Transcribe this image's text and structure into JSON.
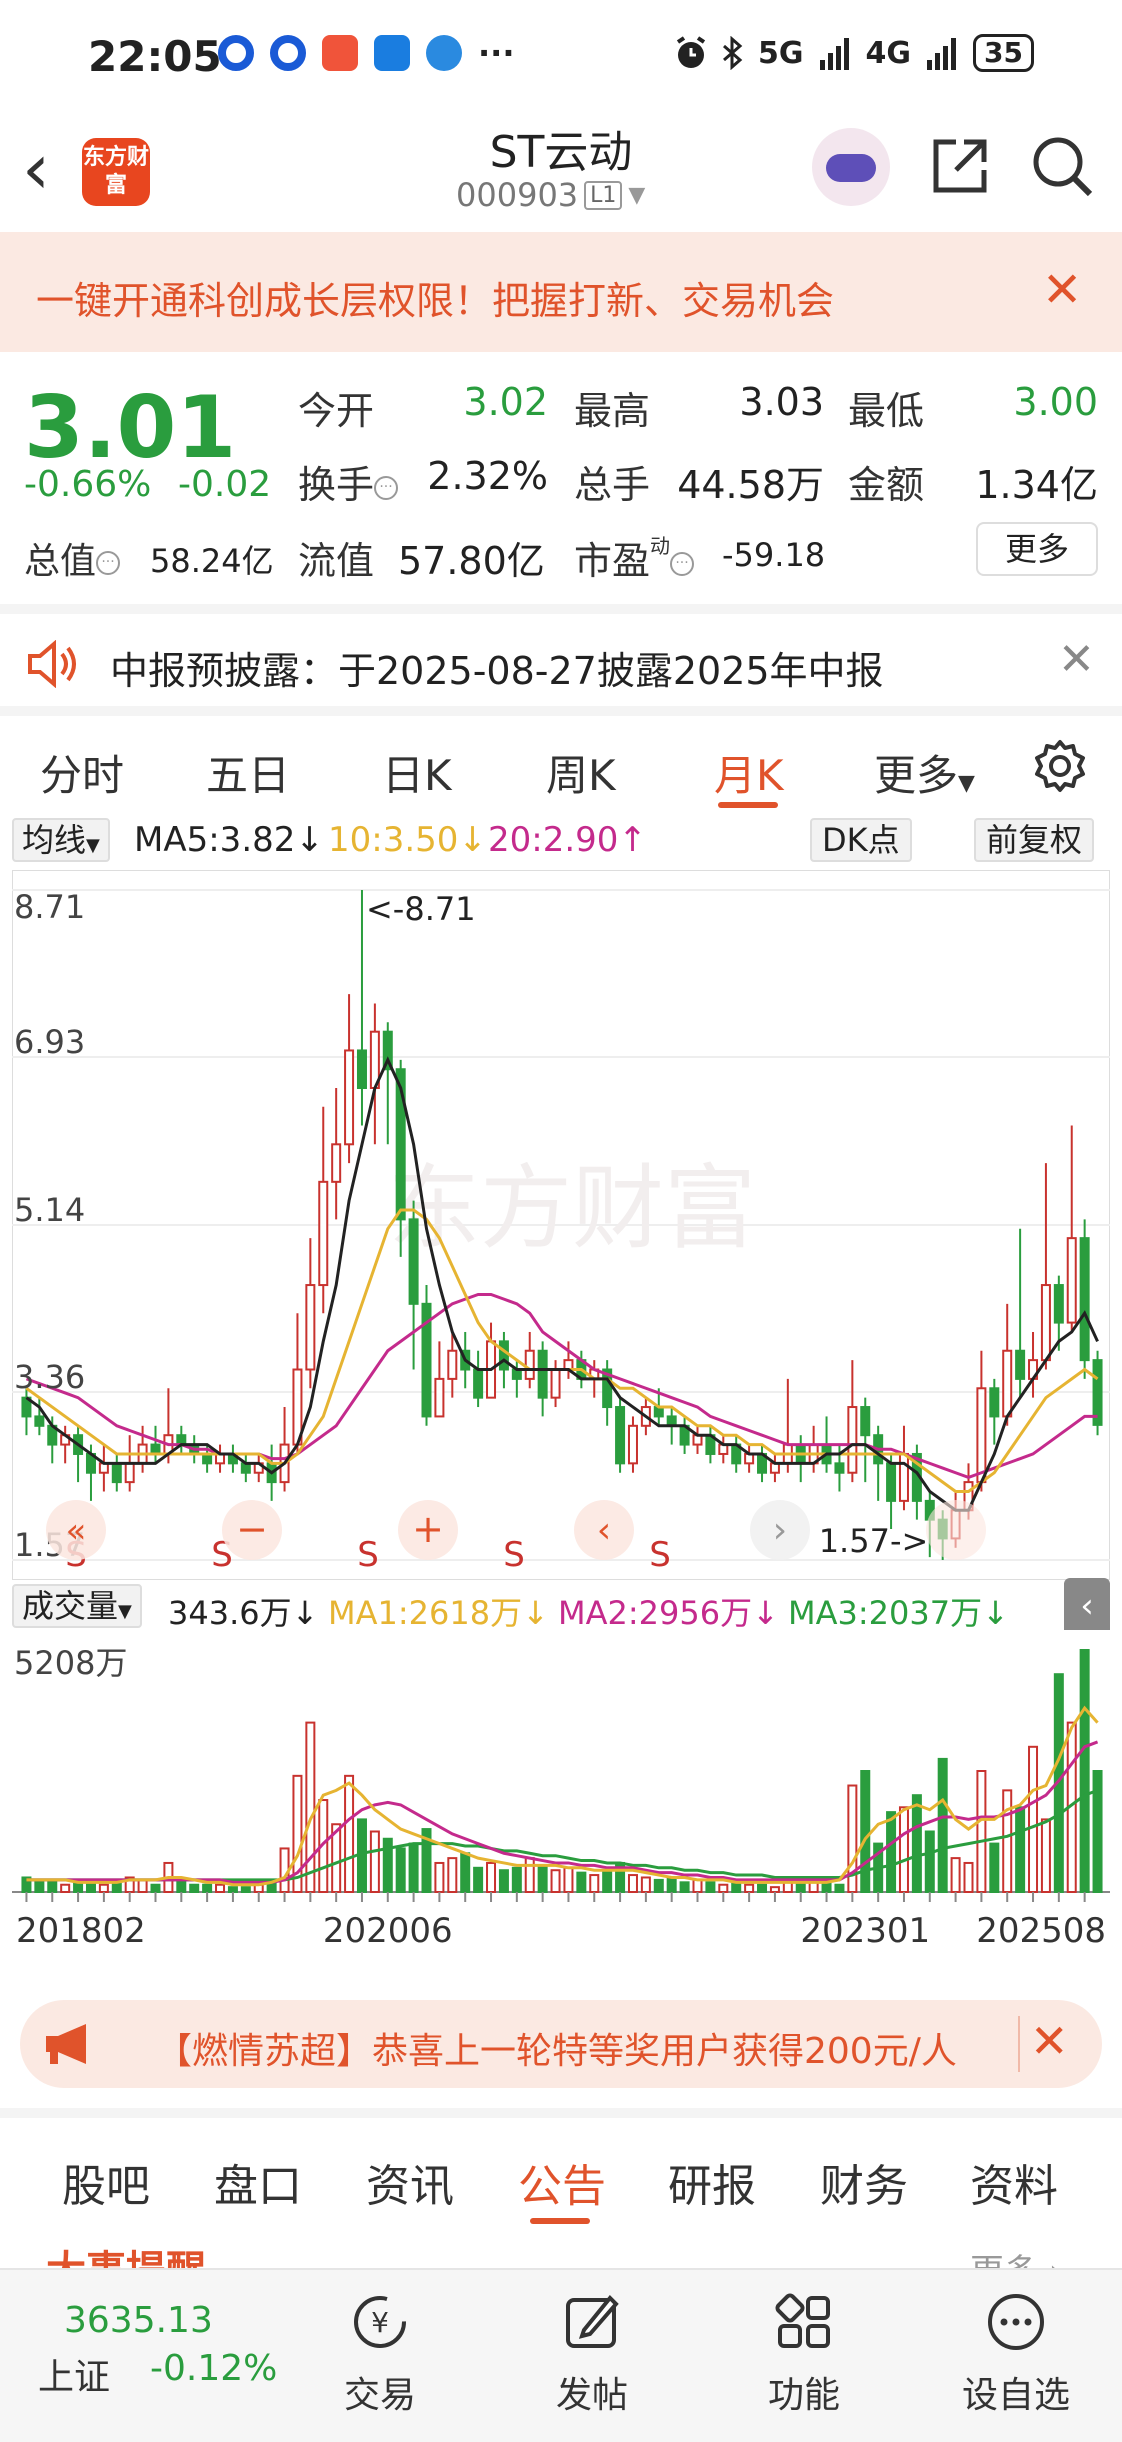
{
  "status_bar": {
    "time": "22:05",
    "network1": "5G",
    "network2": "4G",
    "battery": "35",
    "more": "···"
  },
  "header": {
    "logo_text": "东方财富",
    "stock_name": "ST云动",
    "stock_code": "000903",
    "level": "L1"
  },
  "promo_banner": {
    "text": "一键开通科创成长层权限！把握打新、交易机会"
  },
  "quote": {
    "price": "3.01",
    "change_pct": "-0.66%",
    "change": "-0.02",
    "open_label": "今开",
    "open": "3.02",
    "high_label": "最高",
    "high": "3.03",
    "low_label": "最低",
    "low": "3.00",
    "turnover_label": "换手",
    "turnover": "2.32%",
    "volume_label": "总手",
    "volume": "44.58万",
    "amount_label": "金额",
    "amount": "1.34亿",
    "mktcap_label": "总值",
    "mktcap": "58.24亿",
    "float_label": "流值",
    "float_cap": "57.80亿",
    "pe_label": "市盈",
    "pe_sup": "动",
    "pe": "-59.18",
    "more": "更多"
  },
  "notice": {
    "text": "中报预披露：于2025-08-27披露2025年中报"
  },
  "period_tabs": {
    "items": [
      "分时",
      "五日",
      "日K",
      "周K",
      "月K",
      "更多"
    ],
    "active": "月K"
  },
  "indicator_row": {
    "selector": "均线",
    "ma5": "MA5:3.82↓",
    "ma10": "10:3.50↓",
    "ma20": "20:2.90↑",
    "dk": "DK点",
    "adjust": "前复权"
  },
  "colors": {
    "up": "#c8322e",
    "down": "#2a9d3e",
    "ma5": "#222222",
    "ma10": "#e6b432",
    "ma20": "#c42a8c",
    "accent": "#e0532b"
  },
  "chart_data": [
    {
      "type": "candlestick",
      "y_ticks": [
        "8.71",
        "6.93",
        "5.14",
        "3.36",
        "1.57"
      ],
      "ylim": [
        1.57,
        8.71
      ],
      "max_label": "<-8.71",
      "min_label": "1.57->",
      "watermark": "东方财富",
      "signal_labels": [
        "S",
        "S",
        "S",
        "S",
        "S"
      ],
      "candles": [
        [
          3.3,
          3.1,
          3.4,
          2.9
        ],
        [
          3.1,
          3.0,
          3.3,
          2.9
        ],
        [
          3.0,
          2.8,
          3.1,
          2.6
        ],
        [
          2.8,
          2.9,
          3.0,
          2.6
        ],
        [
          2.9,
          2.7,
          3.0,
          2.4
        ],
        [
          2.7,
          2.5,
          2.8,
          2.2
        ],
        [
          2.5,
          2.6,
          2.8,
          2.3
        ],
        [
          2.6,
          2.4,
          2.7,
          2.3
        ],
        [
          2.4,
          2.6,
          2.9,
          2.3
        ],
        [
          2.6,
          2.8,
          3.0,
          2.5
        ],
        [
          2.8,
          2.7,
          3.0,
          2.6
        ],
        [
          2.7,
          2.9,
          3.4,
          2.6
        ],
        [
          2.9,
          2.8,
          3.0,
          2.7
        ],
        [
          2.8,
          2.7,
          2.9,
          2.6
        ],
        [
          2.7,
          2.6,
          2.8,
          2.5
        ],
        [
          2.6,
          2.7,
          2.8,
          2.5
        ],
        [
          2.7,
          2.6,
          2.8,
          2.5
        ],
        [
          2.6,
          2.5,
          2.7,
          2.4
        ],
        [
          2.5,
          2.6,
          2.7,
          2.4
        ],
        [
          2.6,
          2.4,
          2.8,
          2.2
        ],
        [
          2.4,
          2.8,
          3.2,
          2.3
        ],
        [
          2.8,
          3.6,
          4.2,
          2.7
        ],
        [
          3.6,
          4.5,
          5.0,
          3.4
        ],
        [
          4.5,
          5.6,
          6.4,
          4.2
        ],
        [
          5.6,
          6.0,
          6.6,
          5.2
        ],
        [
          6.0,
          7.0,
          7.6,
          5.8
        ],
        [
          7.0,
          6.6,
          8.71,
          6.2
        ],
        [
          6.6,
          7.2,
          7.5,
          6.0
        ],
        [
          7.2,
          6.8,
          7.3,
          6.0
        ],
        [
          6.8,
          5.2,
          6.9,
          4.8
        ],
        [
          5.2,
          4.3,
          5.4,
          3.6
        ],
        [
          4.3,
          3.1,
          4.5,
          3.0
        ],
        [
          3.1,
          3.5,
          3.9,
          3.1
        ],
        [
          3.5,
          3.8,
          4.0,
          3.3
        ],
        [
          3.8,
          3.6,
          4.0,
          3.4
        ],
        [
          3.6,
          3.3,
          3.8,
          3.2
        ],
        [
          3.3,
          3.9,
          4.1,
          3.3
        ],
        [
          3.9,
          3.6,
          4.0,
          3.4
        ],
        [
          3.6,
          3.5,
          3.7,
          3.3
        ],
        [
          3.5,
          3.8,
          4.0,
          3.4
        ],
        [
          3.8,
          3.3,
          3.9,
          3.1
        ],
        [
          3.3,
          3.6,
          3.7,
          3.2
        ],
        [
          3.6,
          3.7,
          3.9,
          3.5
        ],
        [
          3.7,
          3.5,
          3.8,
          3.4
        ],
        [
          3.5,
          3.6,
          3.7,
          3.3
        ],
        [
          3.6,
          3.2,
          3.7,
          3.0
        ],
        [
          3.2,
          2.6,
          3.3,
          2.5
        ],
        [
          2.6,
          3.0,
          3.1,
          2.5
        ],
        [
          3.0,
          3.2,
          3.3,
          2.9
        ],
        [
          3.2,
          3.1,
          3.4,
          3.0
        ],
        [
          3.1,
          3.0,
          3.2,
          2.8
        ],
        [
          3.0,
          2.8,
          3.1,
          2.7
        ],
        [
          2.8,
          2.9,
          3.0,
          2.7
        ],
        [
          2.9,
          2.7,
          3.0,
          2.6
        ],
        [
          2.7,
          2.8,
          2.9,
          2.6
        ],
        [
          2.8,
          2.6,
          2.9,
          2.5
        ],
        [
          2.6,
          2.7,
          2.8,
          2.5
        ],
        [
          2.7,
          2.5,
          2.8,
          2.4
        ],
        [
          2.5,
          2.6,
          2.7,
          2.4
        ],
        [
          2.6,
          2.8,
          3.5,
          2.5
        ],
        [
          2.8,
          2.6,
          2.9,
          2.4
        ],
        [
          2.6,
          2.8,
          3.0,
          2.5
        ],
        [
          2.8,
          2.6,
          3.1,
          2.5
        ],
        [
          2.6,
          2.5,
          2.8,
          2.3
        ],
        [
          2.5,
          3.2,
          3.7,
          2.4
        ],
        [
          3.2,
          2.9,
          3.3,
          2.4
        ],
        [
          2.9,
          2.6,
          3.0,
          2.2
        ],
        [
          2.6,
          2.2,
          2.7,
          1.9
        ],
        [
          2.2,
          2.7,
          3.0,
          2.1
        ],
        [
          2.7,
          2.2,
          2.8,
          2.0
        ],
        [
          2.2,
          2.0,
          2.3,
          1.6
        ],
        [
          2.0,
          1.8,
          2.1,
          1.57
        ],
        [
          1.8,
          2.1,
          2.3,
          1.7
        ],
        [
          2.1,
          2.4,
          2.6,
          2.0
        ],
        [
          2.4,
          3.4,
          3.8,
          2.3
        ],
        [
          3.4,
          3.1,
          3.5,
          2.8
        ],
        [
          3.1,
          3.8,
          4.3,
          3.0
        ],
        [
          3.8,
          3.5,
          5.1,
          3.3
        ],
        [
          3.5,
          3.7,
          4.0,
          3.3
        ],
        [
          3.7,
          4.5,
          5.8,
          3.6
        ],
        [
          4.5,
          4.1,
          4.6,
          3.8
        ],
        [
          4.1,
          5.0,
          6.2,
          4.0
        ],
        [
          5.0,
          3.7,
          5.2,
          3.5
        ],
        [
          3.7,
          3.01,
          3.8,
          2.9
        ]
      ],
      "ma5": [
        3.3,
        3.2,
        3.0,
        2.9,
        2.8,
        2.7,
        2.6,
        2.6,
        2.6,
        2.6,
        2.6,
        2.7,
        2.8,
        2.8,
        2.8,
        2.7,
        2.7,
        2.6,
        2.6,
        2.5,
        2.6,
        2.8,
        3.2,
        3.9,
        4.5,
        5.4,
        6.0,
        6.6,
        6.9,
        6.6,
        6.0,
        5.1,
        4.5,
        4.0,
        3.7,
        3.6,
        3.6,
        3.7,
        3.6,
        3.6,
        3.6,
        3.6,
        3.6,
        3.5,
        3.5,
        3.5,
        3.3,
        3.2,
        3.1,
        3.0,
        3.0,
        3.0,
        2.9,
        2.9,
        2.8,
        2.8,
        2.7,
        2.7,
        2.6,
        2.6,
        2.6,
        2.6,
        2.7,
        2.7,
        2.8,
        2.8,
        2.7,
        2.6,
        2.6,
        2.5,
        2.3,
        2.2,
        2.1,
        2.1,
        2.4,
        2.7,
        3.1,
        3.3,
        3.5,
        3.7,
        3.9,
        4.0,
        4.2,
        3.9
      ],
      "ma10": [
        3.4,
        3.3,
        3.2,
        3.1,
        3.0,
        2.9,
        2.8,
        2.7,
        2.7,
        2.7,
        2.7,
        2.7,
        2.7,
        2.7,
        2.7,
        2.7,
        2.7,
        2.7,
        2.7,
        2.6,
        2.6,
        2.7,
        2.9,
        3.1,
        3.5,
        3.9,
        4.3,
        4.7,
        5.1,
        5.3,
        5.3,
        5.2,
        5.0,
        4.7,
        4.4,
        4.1,
        3.9,
        3.8,
        3.7,
        3.6,
        3.6,
        3.6,
        3.6,
        3.6,
        3.5,
        3.5,
        3.4,
        3.4,
        3.3,
        3.2,
        3.2,
        3.1,
        3.0,
        3.0,
        2.9,
        2.9,
        2.8,
        2.8,
        2.7,
        2.7,
        2.7,
        2.7,
        2.7,
        2.7,
        2.7,
        2.7,
        2.7,
        2.7,
        2.7,
        2.6,
        2.5,
        2.4,
        2.3,
        2.3,
        2.4,
        2.5,
        2.7,
        2.9,
        3.1,
        3.3,
        3.4,
        3.5,
        3.6,
        3.5
      ],
      "ma20": [
        3.5,
        3.45,
        3.4,
        3.35,
        3.3,
        3.2,
        3.1,
        3.0,
        2.95,
        2.9,
        2.85,
        2.8,
        2.8,
        2.75,
        2.75,
        2.7,
        2.7,
        2.7,
        2.7,
        2.65,
        2.65,
        2.7,
        2.8,
        2.9,
        3.0,
        3.2,
        3.4,
        3.6,
        3.8,
        3.9,
        4.0,
        4.1,
        4.2,
        4.3,
        4.35,
        4.4,
        4.4,
        4.35,
        4.3,
        4.2,
        4.0,
        3.9,
        3.8,
        3.7,
        3.6,
        3.55,
        3.5,
        3.45,
        3.4,
        3.35,
        3.3,
        3.25,
        3.2,
        3.1,
        3.05,
        3.0,
        2.95,
        2.9,
        2.85,
        2.8,
        2.8,
        2.8,
        2.8,
        2.8,
        2.8,
        2.8,
        2.75,
        2.75,
        2.7,
        2.65,
        2.6,
        2.55,
        2.5,
        2.45,
        2.5,
        2.55,
        2.6,
        2.65,
        2.7,
        2.8,
        2.9,
        3.0,
        3.1,
        3.1
      ]
    },
    {
      "type": "volume_bar",
      "y_max_label": "5208万",
      "x_labels": [
        "201802",
        "202006",
        "202301",
        "202508"
      ],
      "volume_ratio": [
        0.06,
        0.04,
        0.05,
        0.03,
        0.04,
        0.05,
        0.03,
        0.04,
        0.06,
        0.05,
        0.03,
        0.12,
        0.05,
        0.03,
        0.03,
        0.03,
        0.02,
        0.02,
        0.03,
        0.05,
        0.18,
        0.48,
        0.7,
        0.38,
        0.28,
        0.48,
        0.3,
        0.25,
        0.22,
        0.18,
        0.2,
        0.26,
        0.12,
        0.14,
        0.16,
        0.1,
        0.12,
        0.09,
        0.1,
        0.14,
        0.11,
        0.09,
        0.1,
        0.08,
        0.07,
        0.09,
        0.12,
        0.07,
        0.06,
        0.05,
        0.06,
        0.04,
        0.05,
        0.04,
        0.03,
        0.04,
        0.03,
        0.03,
        0.02,
        0.06,
        0.04,
        0.06,
        0.04,
        0.03,
        0.44,
        0.5,
        0.2,
        0.33,
        0.35,
        0.4,
        0.25,
        0.55,
        0.14,
        0.12,
        0.5,
        0.2,
        0.42,
        0.35,
        0.6,
        0.3,
        0.9,
        0.7,
        1.0,
        0.5
      ],
      "ma1": [
        0.05,
        0.05,
        0.05,
        0.05,
        0.04,
        0.04,
        0.04,
        0.04,
        0.05,
        0.05,
        0.05,
        0.06,
        0.06,
        0.05,
        0.04,
        0.04,
        0.03,
        0.03,
        0.03,
        0.04,
        0.06,
        0.15,
        0.3,
        0.4,
        0.42,
        0.45,
        0.4,
        0.34,
        0.3,
        0.26,
        0.24,
        0.22,
        0.2,
        0.18,
        0.16,
        0.14,
        0.13,
        0.12,
        0.11,
        0.11,
        0.11,
        0.11,
        0.1,
        0.1,
        0.09,
        0.09,
        0.09,
        0.09,
        0.08,
        0.07,
        0.06,
        0.06,
        0.05,
        0.05,
        0.05,
        0.04,
        0.04,
        0.04,
        0.04,
        0.04,
        0.04,
        0.04,
        0.04,
        0.05,
        0.12,
        0.22,
        0.28,
        0.3,
        0.34,
        0.36,
        0.34,
        0.38,
        0.3,
        0.26,
        0.3,
        0.3,
        0.34,
        0.36,
        0.42,
        0.44,
        0.55,
        0.68,
        0.76,
        0.7
      ],
      "ma2": [
        0.05,
        0.05,
        0.05,
        0.05,
        0.05,
        0.05,
        0.05,
        0.05,
        0.05,
        0.05,
        0.05,
        0.05,
        0.05,
        0.05,
        0.05,
        0.05,
        0.04,
        0.04,
        0.04,
        0.04,
        0.05,
        0.08,
        0.14,
        0.2,
        0.25,
        0.3,
        0.34,
        0.36,
        0.37,
        0.36,
        0.33,
        0.3,
        0.27,
        0.24,
        0.22,
        0.2,
        0.18,
        0.16,
        0.15,
        0.14,
        0.13,
        0.12,
        0.12,
        0.11,
        0.11,
        0.1,
        0.1,
        0.1,
        0.09,
        0.08,
        0.08,
        0.07,
        0.07,
        0.06,
        0.06,
        0.05,
        0.05,
        0.05,
        0.05,
        0.05,
        0.05,
        0.05,
        0.05,
        0.05,
        0.08,
        0.12,
        0.16,
        0.2,
        0.24,
        0.27,
        0.29,
        0.31,
        0.31,
        0.3,
        0.31,
        0.31,
        0.32,
        0.34,
        0.37,
        0.4,
        0.46,
        0.53,
        0.6,
        0.62
      ],
      "ma3": [
        0.05,
        0.05,
        0.05,
        0.05,
        0.05,
        0.05,
        0.05,
        0.05,
        0.05,
        0.05,
        0.05,
        0.05,
        0.05,
        0.05,
        0.05,
        0.05,
        0.05,
        0.05,
        0.05,
        0.05,
        0.05,
        0.06,
        0.08,
        0.1,
        0.12,
        0.14,
        0.16,
        0.17,
        0.18,
        0.19,
        0.2,
        0.2,
        0.2,
        0.2,
        0.19,
        0.19,
        0.18,
        0.17,
        0.17,
        0.16,
        0.15,
        0.15,
        0.14,
        0.13,
        0.13,
        0.12,
        0.12,
        0.11,
        0.11,
        0.1,
        0.1,
        0.09,
        0.09,
        0.08,
        0.08,
        0.07,
        0.07,
        0.07,
        0.06,
        0.06,
        0.06,
        0.06,
        0.06,
        0.06,
        0.07,
        0.09,
        0.1,
        0.11,
        0.13,
        0.15,
        0.16,
        0.18,
        0.19,
        0.2,
        0.21,
        0.22,
        0.23,
        0.25,
        0.27,
        0.29,
        0.32,
        0.36,
        0.4,
        0.42
      ]
    }
  ],
  "volume_row": {
    "selector": "成交量",
    "vol": "343.6万↓",
    "ma1": "MA1:2618万↓",
    "ma2": "MA2:2956万↓",
    "ma3": "MA3:2037万↓"
  },
  "promo2": {
    "text": "【燃情苏超】恭喜上一轮特等奖用户获得200元/人"
  },
  "info_tabs": {
    "items": [
      "股吧",
      "盘口",
      "资讯",
      "公告",
      "研报",
      "财务",
      "资料"
    ],
    "active": "公告"
  },
  "section_peek": {
    "title": "大事提醒",
    "more": "更多"
  },
  "bottom_nav": {
    "index_value": "3635.13",
    "index_name": "上证",
    "index_change": "-0.12%",
    "items": [
      "交易",
      "发帖",
      "功能",
      "设自选"
    ]
  }
}
